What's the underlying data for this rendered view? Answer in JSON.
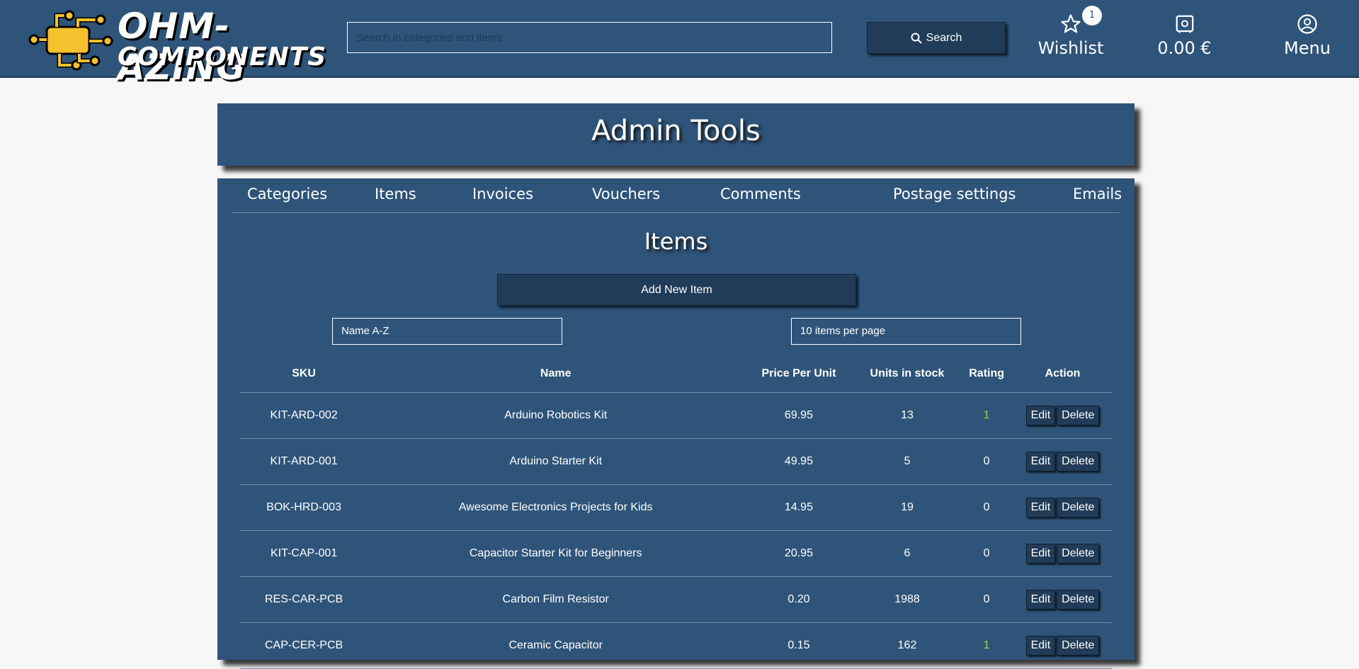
{
  "header": {
    "logo_line1": "OHM-AZING",
    "logo_line2": "COMPONENTS",
    "search_placeholder": "Search in categories and items",
    "search_button": "Search",
    "wishlist_label": "Wishlist",
    "wishlist_count": "1",
    "cart_total": "0.00 €",
    "menu_label": "Menu"
  },
  "page": {
    "title": "Admin Tools",
    "tabs": [
      "Categories",
      "Items",
      "Invoices",
      "Vouchers",
      "Comments",
      "Postage settings",
      "Emails"
    ],
    "section_title": "Items",
    "add_button": "Add New Item",
    "sort_select": "Name A-Z",
    "per_page_select": "10 items per page"
  },
  "table": {
    "headers": [
      "SKU",
      "Name",
      "Price Per Unit",
      "Units in stock",
      "Rating",
      "Action"
    ],
    "rows": [
      {
        "sku": "KIT-ARD-002",
        "name": "Arduino Robotics Kit",
        "price": "69.95",
        "stock": "13",
        "rating": "1"
      },
      {
        "sku": "KIT-ARD-001",
        "name": "Arduino Starter Kit",
        "price": "49.95",
        "stock": "5",
        "rating": "0"
      },
      {
        "sku": "BOK-HRD-003",
        "name": "Awesome Electronics Projects for Kids",
        "price": "14.95",
        "stock": "19",
        "rating": "0"
      },
      {
        "sku": "KIT-CAP-001",
        "name": "Capacitor Starter Kit for Beginners",
        "price": "20.95",
        "stock": "6",
        "rating": "0"
      },
      {
        "sku": "RES-CAR-PCB",
        "name": "Carbon Film Resistor",
        "price": "0.20",
        "stock": "1988",
        "rating": "0"
      },
      {
        "sku": "CAP-CER-PCB",
        "name": "Ceramic Capacitor",
        "price": "0.15",
        "stock": "162",
        "rating": "1"
      }
    ],
    "edit_label": "Edit",
    "delete_label": "Delete"
  },
  "colors": {
    "primary": "#2f5479",
    "dark": "#213c58",
    "rating_positive": "#8be04e",
    "logo_yellow": "#f5c12e"
  }
}
